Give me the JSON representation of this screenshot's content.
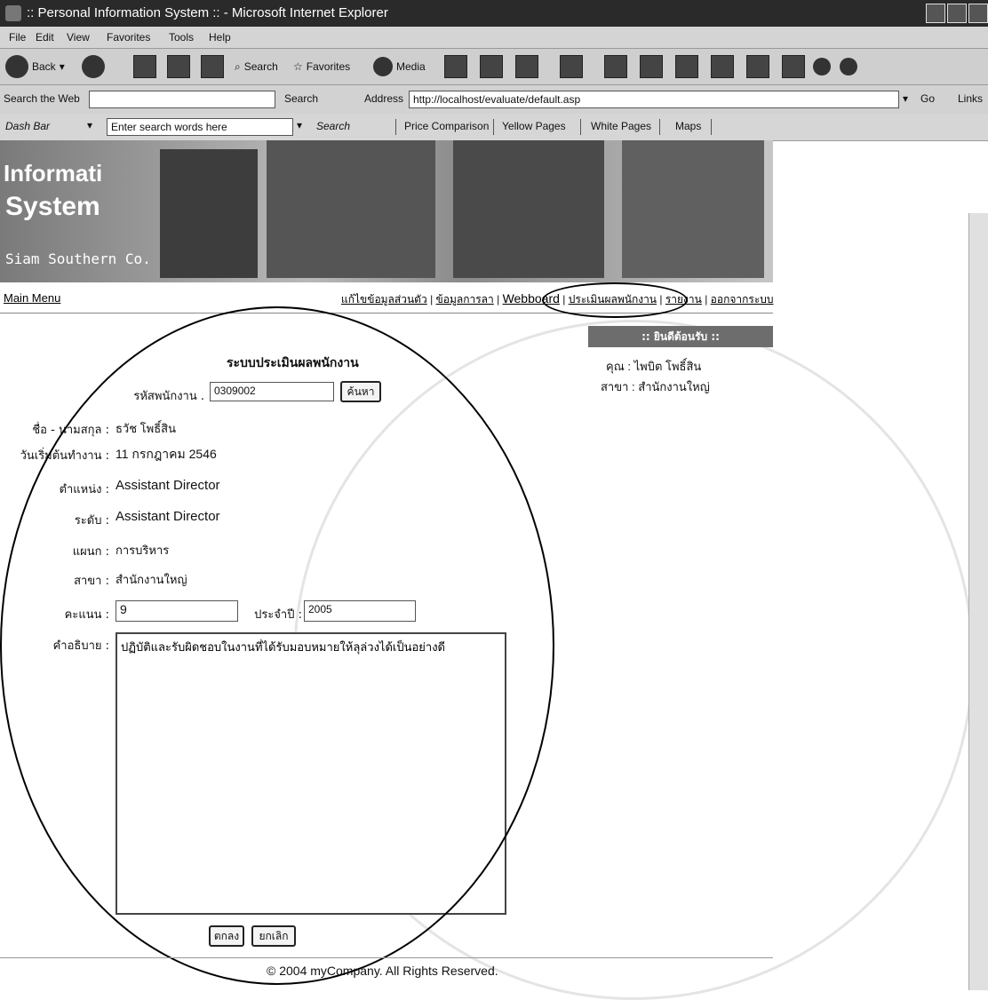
{
  "window": {
    "title": ":: Personal Information System :: - Microsoft Internet Explorer"
  },
  "menu": {
    "items": [
      "File",
      "Edit",
      "View",
      "Favorites",
      "Tools",
      "Help"
    ]
  },
  "toolbar": {
    "back": "Back",
    "search": "Search",
    "favorites": "Favorites",
    "media": "Media"
  },
  "addressbar": {
    "search_web_label": "Search the Web",
    "search_btn": "Search",
    "address_label": "Address",
    "url": "http://localhost/evaluate/default.asp",
    "go": "Go",
    "links": "Links"
  },
  "dashbar": {
    "brand": "Dash Bar",
    "placeholder": "Enter search words here",
    "search": "Search",
    "items": [
      "Price Comparison",
      "Yellow Pages",
      "White Pages",
      "Maps"
    ]
  },
  "banner": {
    "line1": "Informati",
    "line2": "System",
    "line3": "Siam Southern Co."
  },
  "nav": {
    "main_menu": "Main Menu",
    "links": [
      "แก้ไขข้อมูลส่วนตัว",
      "ข้อมูลการลา",
      "Webboard",
      "ประเมินผลพนักงาน",
      "รายงาน",
      "ออกจากระบบ"
    ],
    "separator": "|"
  },
  "welcome": {
    "title": ":: ยินดีต้อนรับ ::",
    "name_line": "คุณ : ไพบิต โพธิ์สิน",
    "branch_line": "สาขา : สำนักงานใหญ่"
  },
  "form": {
    "title": "ระบบประเมินผลพนักงาน",
    "emp_id_label": "รหัสพนักงาน .",
    "emp_id": "0309002",
    "search_btn": "ค้นหา",
    "name_label": "ชื่อ - นามสกุล :",
    "name": "ธวัช โพธิ์สิน",
    "start_label": "วันเริ่มต้นทำงาน :",
    "start": "11 กรกฎาคม 2546",
    "position_label": "ตำแหน่ง :",
    "position": "Assistant Director",
    "level_label": "ระดับ :",
    "level": "Assistant Director",
    "dept_label": "แผนก :",
    "dept": "การบริหาร",
    "branch_label": "สาขา :",
    "branch": "สำนักงานใหญ่",
    "score_label": "คะแนน :",
    "score": "9",
    "year_label": "ประจำปี :",
    "year": "2005",
    "desc_label": "คำอธิบาย :",
    "desc": "ปฏิบัติและรับผิดชอบในงานที่ได้รับมอบหมายให้ลุล่วงได้เป็นอย่างดี",
    "ok_btn": "ตกลง",
    "cancel_btn": "ยกเลิก"
  },
  "footer": {
    "copyright": "© 2004 myCompany. All Rights Reserved."
  }
}
